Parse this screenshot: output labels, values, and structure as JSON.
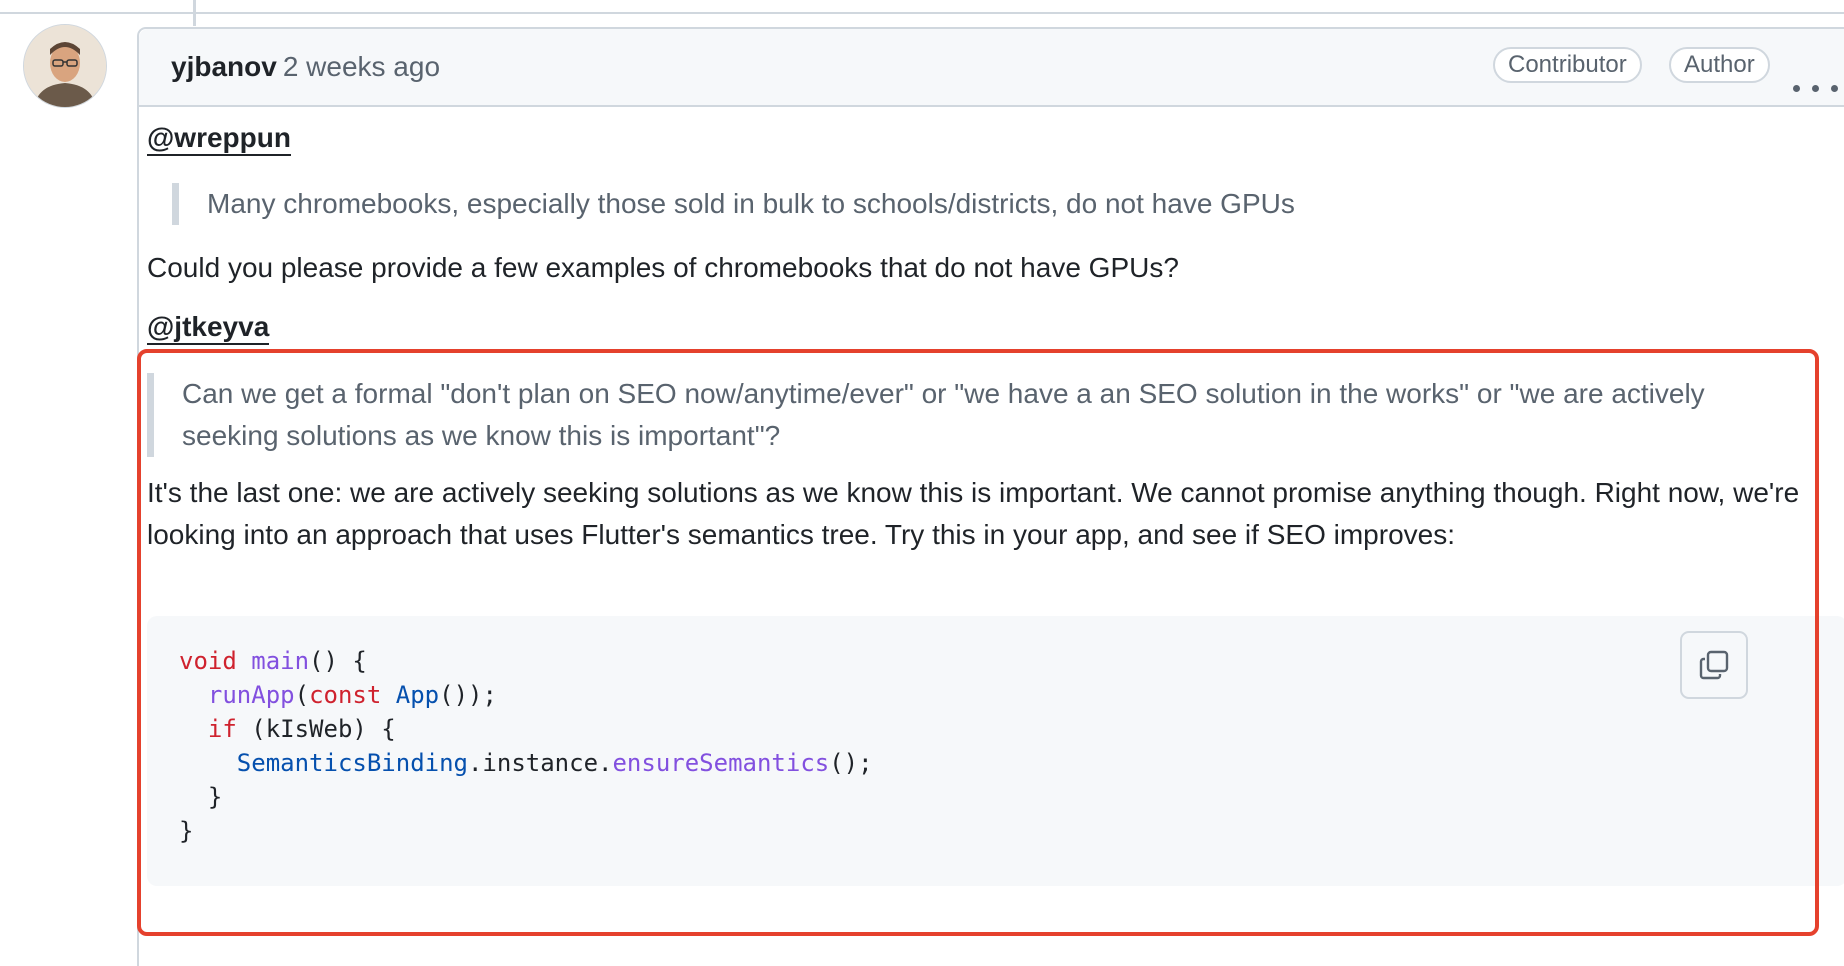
{
  "comment": {
    "author": "yjbanov",
    "timestamp": "2 weeks ago",
    "badges": {
      "contributor": "Contributor",
      "author": "Author"
    },
    "avatar_icon": "user-avatar",
    "menu_icon": "kebab-horizontal-icon"
  },
  "body": {
    "mention1": "@wreppun",
    "quote1": "Many chromebooks, especially those sold in bulk to schools/districts, do not have GPUs",
    "reply1": "Could you please provide a few examples of chromebooks that do not have GPUs?",
    "mention2": "@jtkeyva",
    "quote2": "Can we get a formal \"don't plan on SEO now/anytime/ever\" or \"we have a an SEO solution in the works\" or \"we are actively seeking solutions as we know this is important\"?",
    "reply2": "It's the last one: we are actively seeking solutions as we know this is important. We cannot promise anything though. Right now, we're looking into an approach that uses Flutter's semantics tree. Try this in your app, and see if SEO improves:"
  },
  "code": {
    "l1_kw": "void",
    "l1_fn": "main",
    "l1_rest": "() {",
    "l2_fn": "runApp",
    "l2_open": "(",
    "l2_kw": "const",
    "l2_ty": "App",
    "l2_rest": "());",
    "l3_kw": "if",
    "l3_rest": " (kIsWeb) {",
    "l4_ty": "SemanticsBinding",
    "l4_mid": ".instance.",
    "l4_fn": "ensureSemantics",
    "l4_rest": "();",
    "l5": "}",
    "l6": "}",
    "copy_icon": "copy-icon"
  },
  "colors": {
    "highlight": "#e5412d",
    "keyword": "#cf222e",
    "function": "#8250df",
    "type": "#0550ae"
  }
}
